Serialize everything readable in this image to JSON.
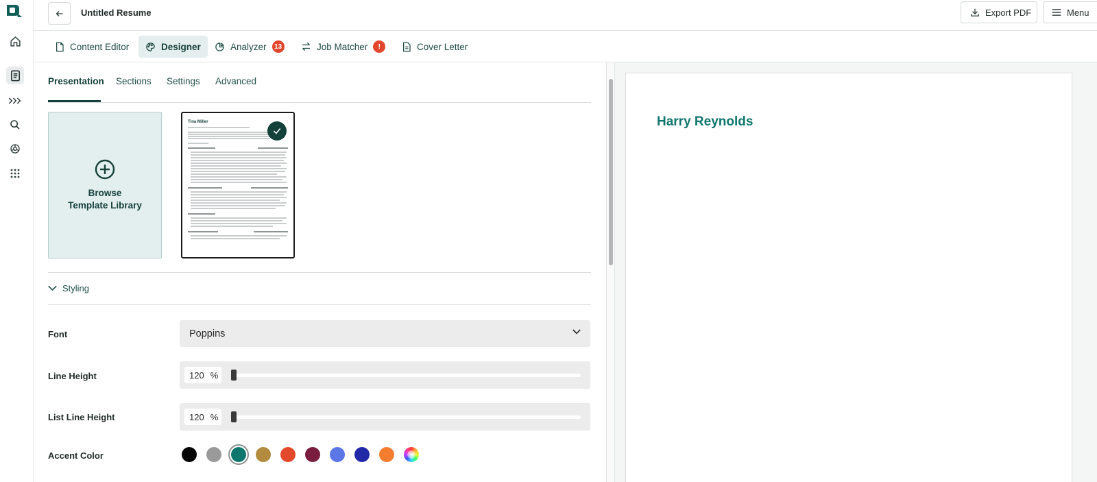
{
  "header": {
    "title": "Untitled Resume",
    "export_label": "Export PDF",
    "menu_label": "Menu"
  },
  "tabs": [
    {
      "label": "Content Editor"
    },
    {
      "label": "Designer"
    },
    {
      "label": "Analyzer",
      "badge": "13"
    },
    {
      "label": "Job Matcher",
      "badge": "!"
    },
    {
      "label": "Cover Letter"
    }
  ],
  "subtabs": [
    {
      "label": "Presentation"
    },
    {
      "label": "Sections"
    },
    {
      "label": "Settings"
    },
    {
      "label": "Advanced"
    }
  ],
  "template": {
    "browse_label_1": "Browse",
    "browse_label_2": "Template Library",
    "thumb_name": "Tina Miller"
  },
  "styling": {
    "toggle_label": "Styling",
    "font_label": "Font",
    "font_value": "Poppins",
    "line_height_label": "Line Height",
    "line_height_value": "120",
    "list_line_height_label": "List Line Height",
    "list_line_height_value": "120",
    "percent": "%",
    "accent_label": "Accent Color",
    "accent_colors": [
      "#050505",
      "#9a9a9a",
      "#0f766e",
      "#b28b3e",
      "#e24a2b",
      "#7a1d3f",
      "#5b77e6",
      "#2229a8",
      "#f47d30",
      "rainbow"
    ],
    "accent_selected": "#0f766e"
  },
  "preview": {
    "name": "Harry Reynolds",
    "accent": "#0f766e"
  }
}
